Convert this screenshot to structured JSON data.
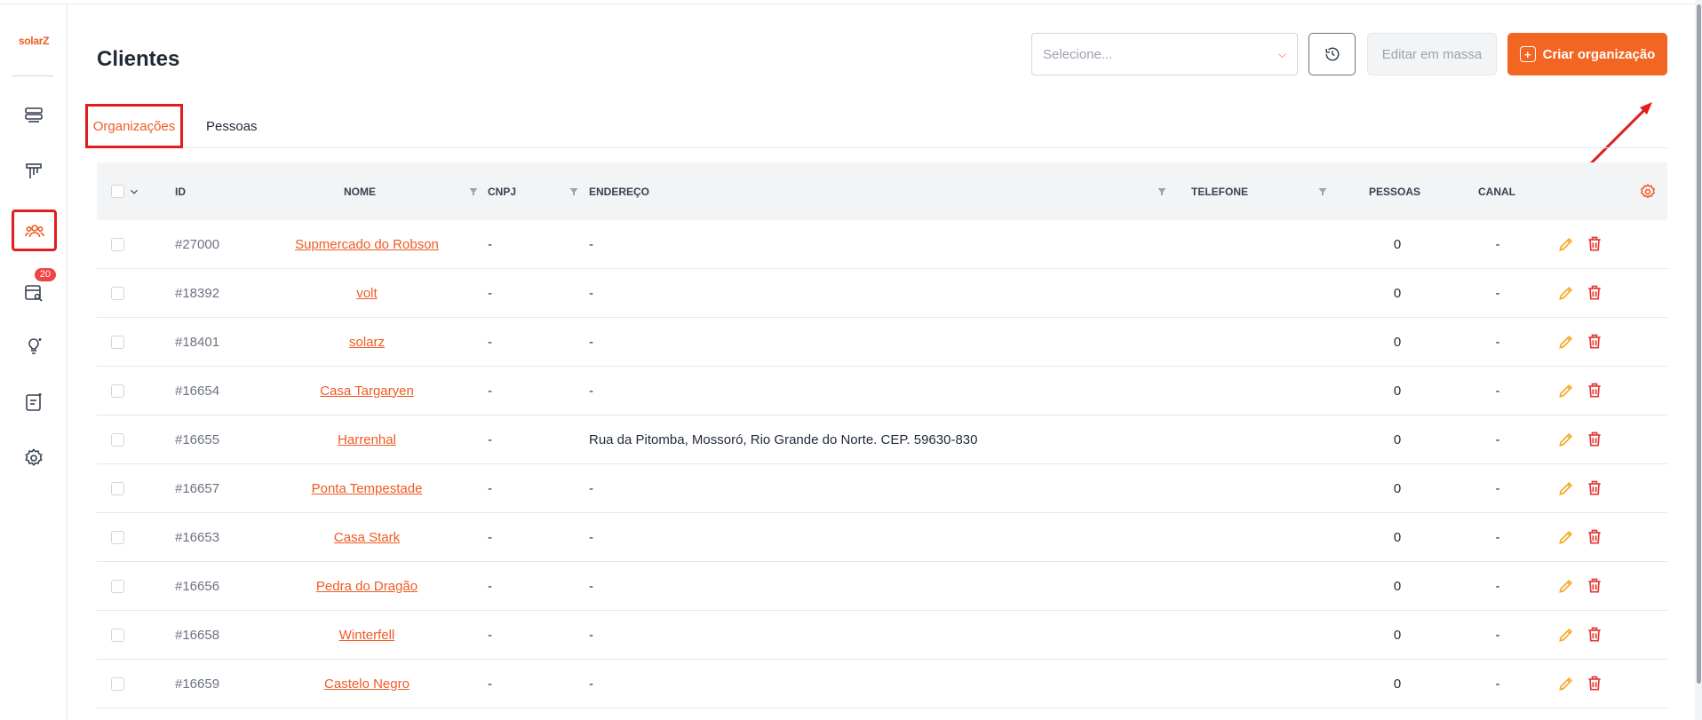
{
  "app": {
    "logo_text": "solarZ"
  },
  "sidebar": {
    "items": [
      {
        "name": "dashboard-icon"
      },
      {
        "name": "kanban-icon"
      },
      {
        "name": "clients-icon",
        "active": true
      },
      {
        "name": "calendar-search-icon",
        "badge": "20"
      },
      {
        "name": "lightbulb-icon"
      },
      {
        "name": "document-icon"
      },
      {
        "name": "gear-icon"
      }
    ]
  },
  "header": {
    "title": "Clientes",
    "select_placeholder": "Selecione...",
    "bulk_edit_label": "Editar em massa",
    "create_label": "Criar organização"
  },
  "tabs": [
    {
      "label": "Organizações",
      "active": true
    },
    {
      "label": "Pessoas",
      "active": false
    }
  ],
  "table": {
    "columns": {
      "id": "ID",
      "nome": "NOME",
      "cnpj": "CNPJ",
      "endereco": "ENDEREÇO",
      "telefone": "TELEFONE",
      "pessoas": "PESSOAS",
      "canal": "CANAL"
    },
    "rows": [
      {
        "id": "#27000",
        "nome": "Supmercado do Robson",
        "cnpj": "-",
        "endereco": "-",
        "telefone": "",
        "pessoas": "0",
        "canal": "-"
      },
      {
        "id": "#18392",
        "nome": "volt",
        "cnpj": "-",
        "endereco": "-",
        "telefone": "",
        "pessoas": "0",
        "canal": "-"
      },
      {
        "id": "#18401",
        "nome": "solarz",
        "cnpj": "-",
        "endereco": "-",
        "telefone": "",
        "pessoas": "0",
        "canal": "-"
      },
      {
        "id": "#16654",
        "nome": "Casa Targaryen",
        "cnpj": "-",
        "endereco": "-",
        "telefone": "",
        "pessoas": "0",
        "canal": "-"
      },
      {
        "id": "#16655",
        "nome": "Harrenhal",
        "cnpj": "-",
        "endereco": "Rua da Pitomba, Mossoró, Rio Grande do Norte. CEP. 59630-830",
        "telefone": "",
        "pessoas": "0",
        "canal": "-"
      },
      {
        "id": "#16657",
        "nome": "Ponta Tempestade",
        "cnpj": "-",
        "endereco": "-",
        "telefone": "",
        "pessoas": "0",
        "canal": "-"
      },
      {
        "id": "#16653",
        "nome": "Casa Stark",
        "cnpj": "-",
        "endereco": "-",
        "telefone": "",
        "pessoas": "0",
        "canal": "-"
      },
      {
        "id": "#16656",
        "nome": "Pedra do Dragão",
        "cnpj": "-",
        "endereco": "-",
        "telefone": "",
        "pessoas": "0",
        "canal": "-"
      },
      {
        "id": "#16658",
        "nome": "Winterfell",
        "cnpj": "-",
        "endereco": "-",
        "telefone": "",
        "pessoas": "0",
        "canal": "-"
      },
      {
        "id": "#16659",
        "nome": "Castelo Negro",
        "cnpj": "-",
        "endereco": "-",
        "telefone": "",
        "pessoas": "0",
        "canal": "-"
      }
    ]
  },
  "colors": {
    "accent": "#f26522",
    "highlight": "#e11d1d",
    "edit": "#f5a623",
    "delete": "#e53935"
  }
}
